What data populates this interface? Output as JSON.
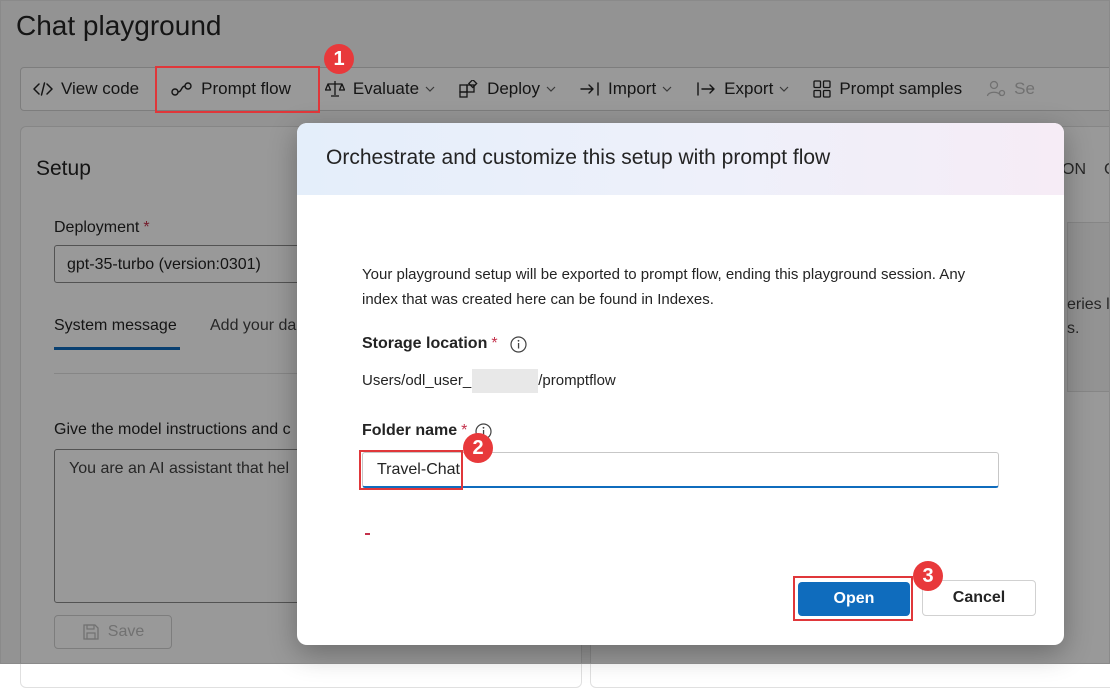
{
  "page": {
    "title": "Chat playground"
  },
  "toolbar": {
    "items": [
      {
        "label": "View code"
      },
      {
        "label": "Prompt flow"
      },
      {
        "label": "Evaluate"
      },
      {
        "label": "Deploy"
      },
      {
        "label": "Import"
      },
      {
        "label": "Export"
      },
      {
        "label": "Prompt samples"
      },
      {
        "label": "Se"
      }
    ]
  },
  "setup": {
    "title": "Setup",
    "deployment_label": "Deployment",
    "deployment_value": "gpt-35-turbo (version:0301)",
    "tabs": [
      "System message",
      "Add your da"
    ],
    "instructions": "Give the model instructions and c",
    "system_message": "You are an AI assistant that hel",
    "save_label": "Save"
  },
  "right_panel": {
    "header_fragment": "ON",
    "header_fragment2": "C",
    "frag1": "eries l",
    "frag2": "s."
  },
  "dialog": {
    "title": "Orchestrate and customize this setup with prompt flow",
    "description": "Your playground setup will be exported to prompt flow, ending this playground session. Any index that was created here can be found in Indexes.",
    "storage_label": "Storage location",
    "storage_prefix": "Users/odl_user_",
    "storage_suffix": "/promptflow",
    "folder_label": "Folder name",
    "folder_value": "Travel-Chat",
    "required_mark": "*",
    "open_label": "Open",
    "cancel_label": "Cancel"
  },
  "steps": [
    "1",
    "2",
    "3"
  ],
  "colors": {
    "accent": "#0f6cbd",
    "highlight": "#e0373a",
    "required": "#c4314b"
  }
}
